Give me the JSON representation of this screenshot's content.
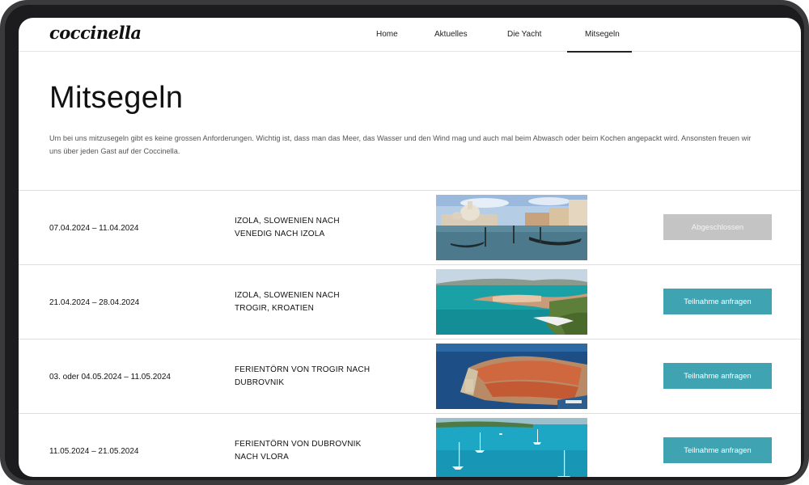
{
  "brand": {
    "logo_text": "coccinella"
  },
  "nav": {
    "items": [
      {
        "label": "Home"
      },
      {
        "label": "Aktuelles"
      },
      {
        "label": "Die Yacht"
      },
      {
        "label": "Mitsegeln",
        "active": true
      }
    ]
  },
  "page": {
    "title": "Mitsegeln",
    "intro": "Um bei uns mitzusegeln gibt es keine grossen Anforderungen. Wichtig ist, dass man das Meer, das Wasser und den Wind mag und auch mal beim Abwasch oder beim Kochen angepackt wird. Ansonsten freuen wir uns über jeden Gast auf der Coccinella."
  },
  "colors": {
    "accent": "#3fa3b2",
    "disabled": "#c4c4c4"
  },
  "trips": [
    {
      "date": "07.04.2024 – 11.04.2024",
      "route": "IZOLA, SLOWENIEN NACH VENEDIG NACH IZOLA",
      "button": "Abgeschlossen",
      "status": "closed"
    },
    {
      "date": "21.04.2024 – 28.04.2024",
      "route": "IZOLA, SLOWENIEN NACH TROGIR, KROATIEN",
      "button": "Teilnahme anfragen",
      "status": "open"
    },
    {
      "date": "03. oder 04.05.2024 – 11.05.2024",
      "route": "FERIENTÖRN VON TROGIR NACH DUBROVNIK",
      "button": "Teilnahme anfragen",
      "status": "open"
    },
    {
      "date": "11.05.2024 – 21.05.2024",
      "route": "FERIENTÖRN VON DUBROVNIK NACH VLORA",
      "button": "Teilnahme anfragen",
      "status": "open"
    }
  ]
}
